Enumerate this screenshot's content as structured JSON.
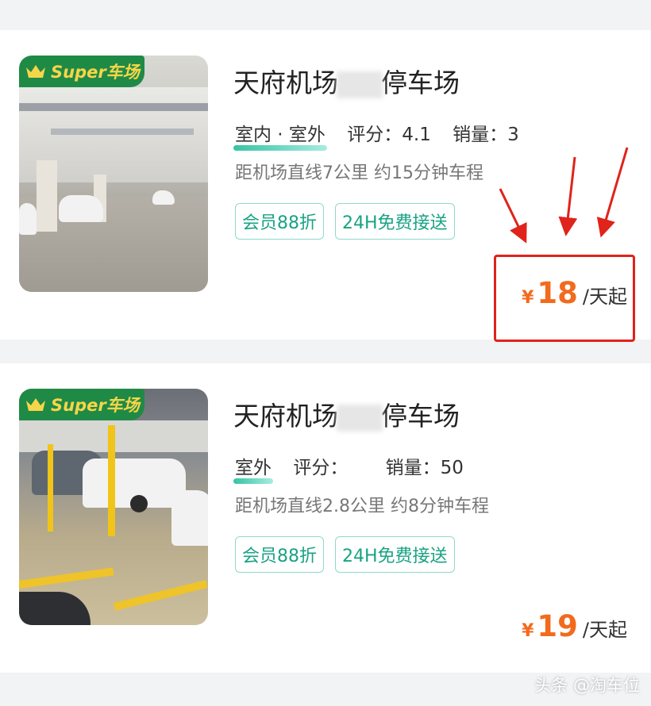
{
  "listings": [
    {
      "badge": "Super车场",
      "title_start": "天府机场",
      "title_end": "停车场",
      "location": "室内 · 室外",
      "rating_label": "评分：",
      "rating_value": "4.1",
      "sales_label": "销量：",
      "sales_value": "3",
      "distance": "距机场直线7公里 约15分钟车程",
      "tags": [
        "会员88折",
        "24H免费接送"
      ],
      "price_currency": "¥",
      "price_value": "18",
      "price_unit": "/天起"
    },
    {
      "badge": "Super车场",
      "title_start": "天府机场",
      "title_end": "停车场",
      "location": "室外",
      "rating_label": "评分：",
      "rating_value": "",
      "sales_label": "销量：",
      "sales_value": "50",
      "distance": "距机场直线2.8公里 约8分钟车程",
      "tags": [
        "会员88折",
        "24H免费接送"
      ],
      "price_currency": "¥",
      "price_value": "19",
      "price_unit": "/天起"
    }
  ],
  "watermark": "头条 @淘车位",
  "colors": {
    "brand_green": "#1f8a45",
    "badge_text": "#f7d54a",
    "tag_green": "#18a383",
    "price_orange": "#f26b1d",
    "highlight_red": "#e0231b"
  }
}
